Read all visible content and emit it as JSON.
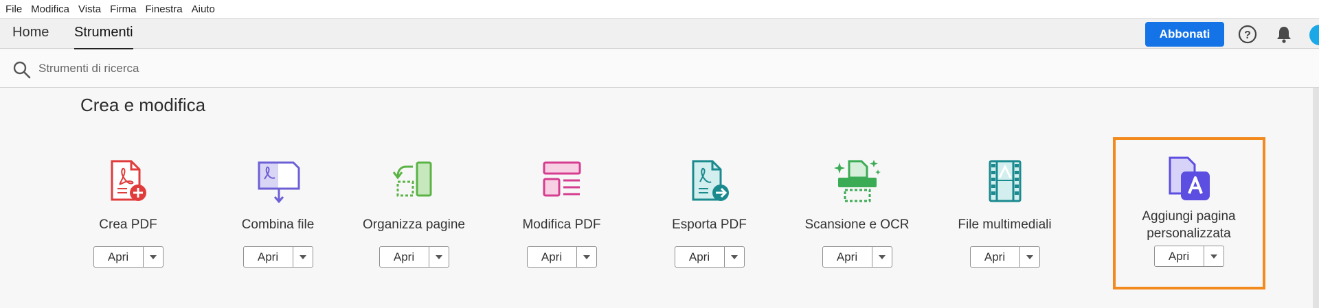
{
  "menubar": {
    "items": [
      "File",
      "Modifica",
      "Vista",
      "Firma",
      "Finestra",
      "Aiuto"
    ]
  },
  "tabs": {
    "home": "Home",
    "tools": "Strumenti"
  },
  "header": {
    "subscribe_label": "Abbonati",
    "help_icon": "help-icon",
    "bell_icon": "bell-icon"
  },
  "search": {
    "placeholder": "Strumenti di ricerca",
    "value": ""
  },
  "section": {
    "title": "Crea e modifica"
  },
  "tools": [
    {
      "name": "Crea PDF",
      "open": "Apri",
      "icon": "create-pdf-icon",
      "color": "#e03c3c"
    },
    {
      "name": "Combina file",
      "open": "Apri",
      "icon": "combine-files-icon",
      "color": "#6d5fd6"
    },
    {
      "name": "Organizza pagine",
      "open": "Apri",
      "icon": "organize-pages-icon",
      "color": "#5bb346"
    },
    {
      "name": "Modifica PDF",
      "open": "Apri",
      "icon": "edit-pdf-icon",
      "color": "#d63c8f"
    },
    {
      "name": "Esporta PDF",
      "open": "Apri",
      "icon": "export-pdf-icon",
      "color": "#1b8a8f"
    },
    {
      "name": "Scansione e OCR",
      "open": "Apri",
      "icon": "scan-ocr-icon",
      "color": "#3cab55"
    },
    {
      "name": "File multimediali",
      "open": "Apri",
      "icon": "media-files-icon",
      "color": "#1b8a8f"
    },
    {
      "name": "Aggiungi pagina personalizzata",
      "open": "Apri",
      "icon": "custom-page-icon",
      "color": "#5c4ee0"
    }
  ],
  "colors": {
    "accent": "#1473e6",
    "highlight": "#f28a1e"
  }
}
